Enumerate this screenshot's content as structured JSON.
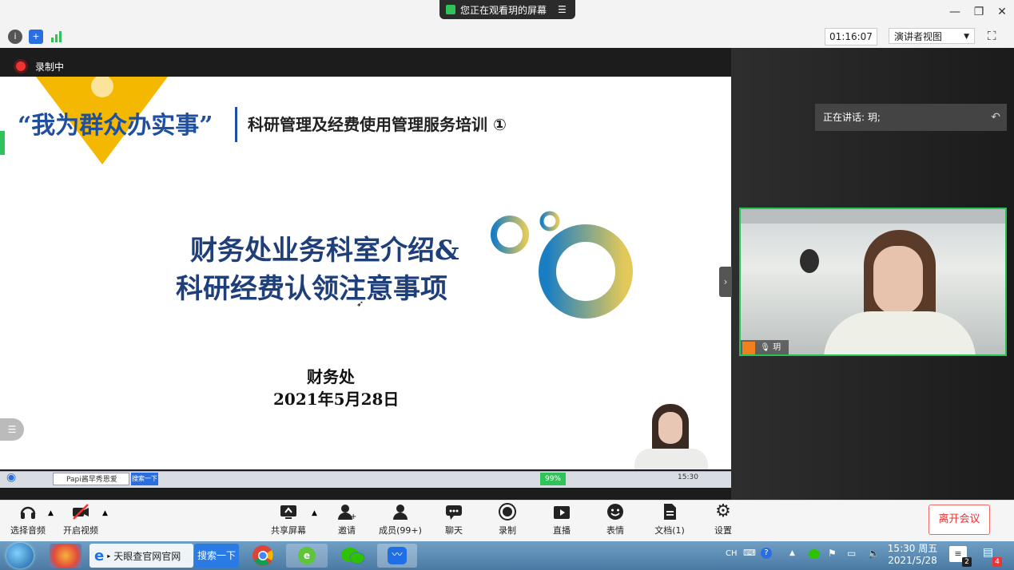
{
  "window": {
    "share_status": "您正在观看玥的屏幕",
    "timer": "01:16:07",
    "presenter_view": "演讲者视图",
    "recording": "录制中"
  },
  "slide": {
    "header_slogan": "“我为群众办实事”",
    "header_title": "科研管理及经费使用管理服务培训 ①",
    "main_title_line1": "财务处业务科室介绍&",
    "main_title_line2": "科研经费认领注意事项",
    "department": "财务处",
    "date": "2021年5月28日",
    "taskbar": {
      "search_placeholder": "Papi酱早秀恩爱",
      "search_button": "搜索一下",
      "battery": "99%",
      "time": "15:30"
    }
  },
  "right_panel": {
    "speaking": "正在讲话: 玥;",
    "participant_name": "玥"
  },
  "controls": {
    "audio": "选择音频",
    "video": "开启视频",
    "share": "共享屏幕",
    "invite": "邀请",
    "members": "成员(99+)",
    "chat": "聊天",
    "record": "录制",
    "live": "直播",
    "emoji": "表情",
    "docs": "文档(1)",
    "settings": "设置",
    "leave": "离开会议"
  },
  "taskbar": {
    "ie_label": "天眼查官网官网",
    "search_button": "搜索一下",
    "tray_lang": "CH",
    "time": "15:30 周五",
    "date": "2021/5/28",
    "notif_badge": "2",
    "mail_badge": "4"
  },
  "colors": {
    "accent_green": "#27c253",
    "leave_red": "#e33333",
    "slide_blue": "#1f3f7a"
  }
}
